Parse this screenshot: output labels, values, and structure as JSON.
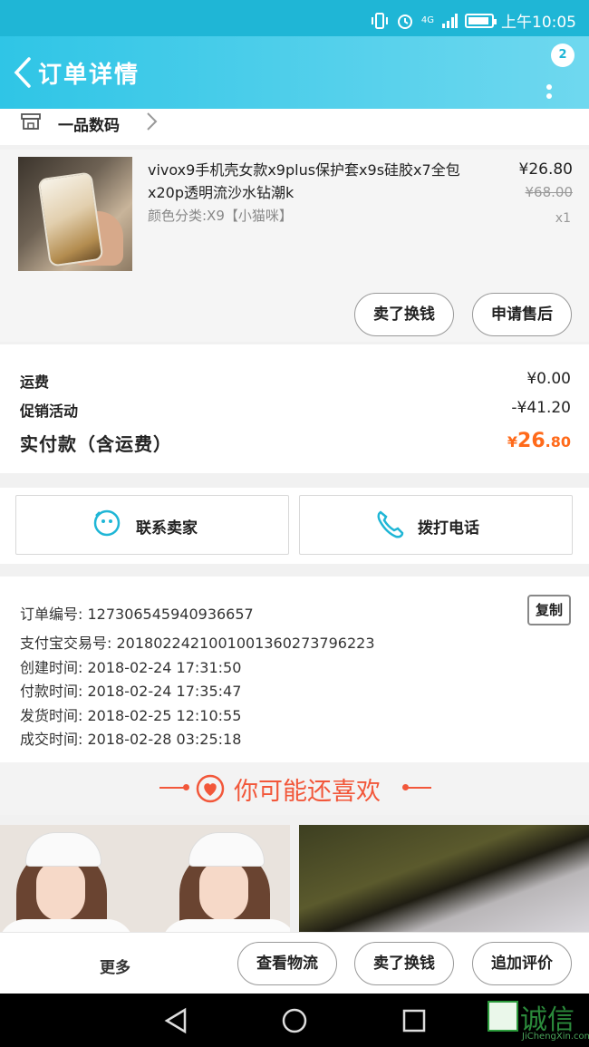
{
  "status_bar": {
    "time": "上午10:05",
    "signal": "4G"
  },
  "app_bar": {
    "title": "订单详情",
    "badge": "2"
  },
  "shop": {
    "name": "一品数码"
  },
  "product": {
    "title": "vivox9手机壳女款x9plus保护套x9s硅胶x7全包x20p透明流沙水钻潮k",
    "spec": "颜色分类:X9【小猫咪】",
    "price": "¥26.80",
    "original_price": "¥68.00",
    "quantity": "x1",
    "buttons": {
      "sell": "卖了换钱",
      "after_sale": "申请售后"
    }
  },
  "summary": {
    "shipping_label": "运费",
    "shipping_value": "¥0.00",
    "promo_label": "促销活动",
    "promo_value": "-¥41.20",
    "total_label": "实付款（含运费）",
    "total_prefix": "¥",
    "total_int": "26",
    "total_dec": ".80"
  },
  "contact": {
    "seller": "联系卖家",
    "call": "拨打电话"
  },
  "order_details": {
    "order_no": "订单编号: 127306545940936657",
    "alipay_no": "支付宝交易号: 2018022421001001360273796223",
    "created": "创建时间: 2018-02-24 17:31:50",
    "paid": "付款时间: 2018-02-24 17:35:47",
    "shipped": "发货时间: 2018-02-25 12:10:55",
    "completed": "成交时间: 2018-02-28 03:25:18",
    "copy": "复制"
  },
  "recommend": {
    "title": "你可能还喜欢"
  },
  "bottom_bar": {
    "more": "更多",
    "logistics": "查看物流",
    "sell": "卖了换钱",
    "review": "追加评价"
  },
  "watermark": {
    "text": "诚信",
    "sub": "JiChengXin.com"
  },
  "colors": {
    "accent": "#1fb6d6",
    "price": "#ff6a1a",
    "recommend": "#f2573a"
  }
}
